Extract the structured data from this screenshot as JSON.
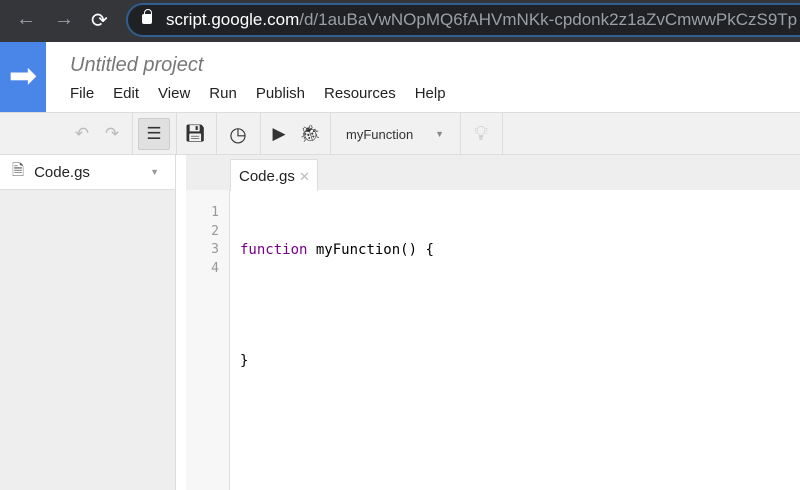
{
  "browser": {
    "url_host": "script.google.com",
    "url_path": "/d/1auBaVwNOpMQ6fAHVmNKk-cpdonk2z1aZvCmwwPkCzS9Tp"
  },
  "header": {
    "title": "Untitled project",
    "menu": [
      "File",
      "Edit",
      "View",
      "Run",
      "Publish",
      "Resources",
      "Help"
    ]
  },
  "toolbar": {
    "function_select": "myFunction"
  },
  "sidebar": {
    "files": [
      {
        "name": "Code.gs"
      }
    ]
  },
  "editor": {
    "tab": "Code.gs",
    "line_numbers": [
      "1",
      "2",
      "3",
      "4"
    ],
    "lines": [
      {
        "keyword": "function",
        "rest": " myFunction() {"
      },
      {
        "text": ""
      },
      {
        "text": "}"
      },
      {
        "text": ""
      }
    ]
  },
  "colors": {
    "brand": "#4a86e8",
    "keyword": "#770088"
  }
}
